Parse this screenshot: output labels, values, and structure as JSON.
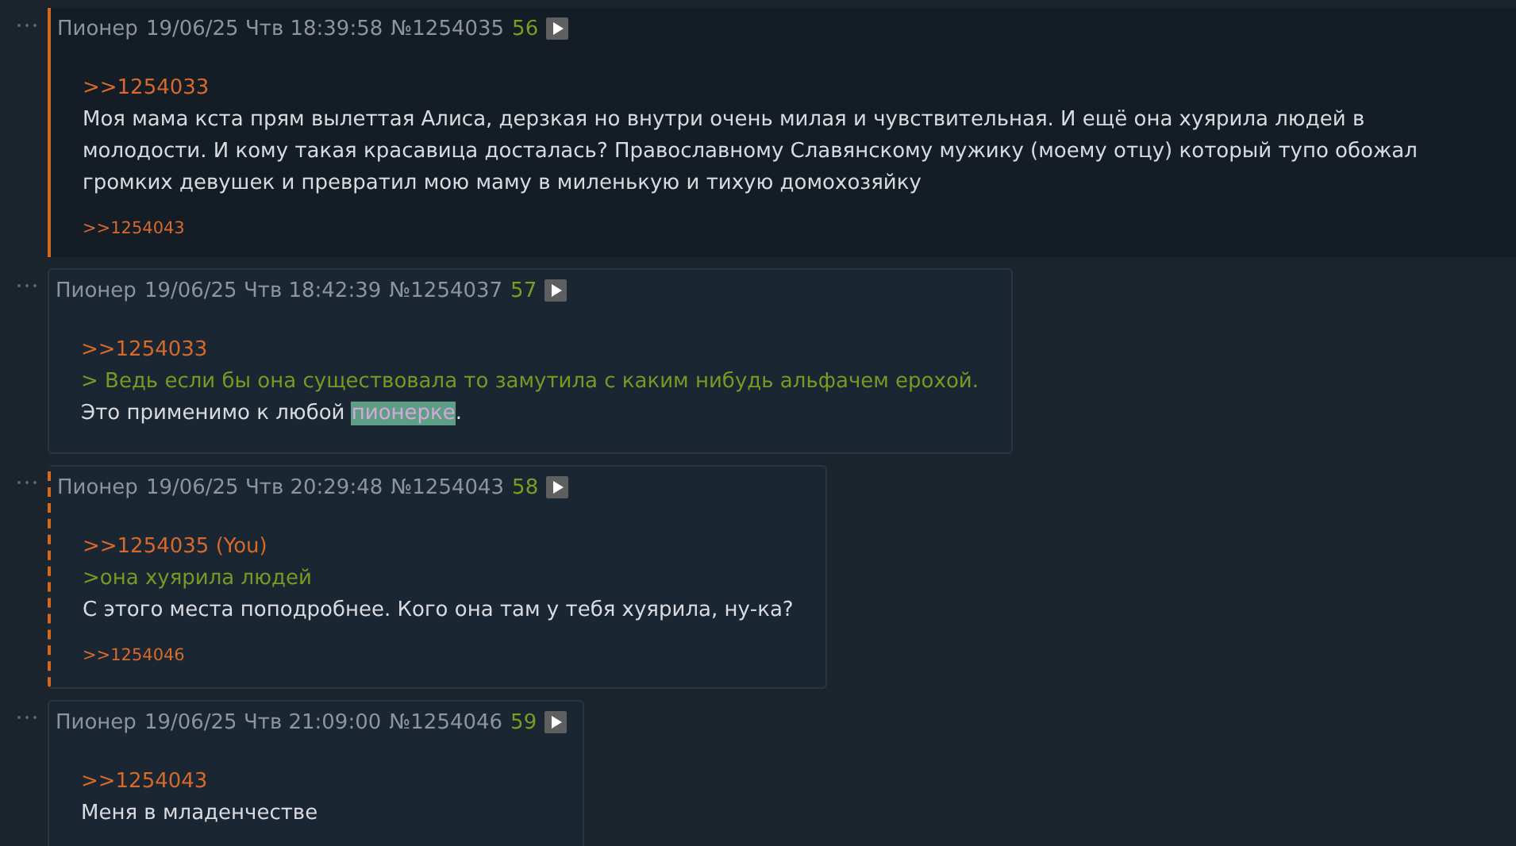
{
  "posts": [
    {
      "kind": "highlighted",
      "name": "Пионер",
      "date": "19/06/25 Чтв 18:39:58",
      "number": "№1254035",
      "counter": "56",
      "lines": [
        {
          "kind": "link",
          "parts": [
            {
              "text": ">>1254033"
            }
          ]
        },
        {
          "kind": "text",
          "parts": [
            {
              "text": "Моя мама кста прям вылеттая Алиса, дерзкая но внутри очень милая и чувствительная. И ещё она хуярила людей в молодости. И кому такая красавица досталась? Православному Славянскому мужику (моему отцу) который тупо обожал громких девушек и превратил мою маму в миленькую и тихую домохозяйку"
            }
          ]
        }
      ],
      "replies": [
        ">>1254043"
      ]
    },
    {
      "kind": "normal",
      "name": "Пионер",
      "date": "19/06/25 Чтв 18:42:39",
      "number": "№1254037",
      "counter": "57",
      "lines": [
        {
          "kind": "link",
          "parts": [
            {
              "text": ">>1254033"
            }
          ]
        },
        {
          "kind": "quote",
          "parts": [
            {
              "text": "> Ведь если бы она существовала то замутила с каким нибудь альфачем ерохой."
            }
          ]
        },
        {
          "kind": "text",
          "parts": [
            {
              "text": "Это применимо к любой "
            },
            {
              "text": "пионерке",
              "kind": "spoiler"
            },
            {
              "text": "."
            }
          ]
        }
      ]
    },
    {
      "kind": "reply-target",
      "name": "Пионер",
      "date": "19/06/25 Чтв 20:29:48",
      "number": "№1254043",
      "counter": "58",
      "lines": [
        {
          "kind": "link",
          "parts": [
            {
              "text": ">>1254035 (You)"
            }
          ]
        },
        {
          "kind": "quote",
          "parts": [
            {
              "text": ">она хуярила людей"
            }
          ]
        },
        {
          "kind": "text",
          "parts": [
            {
              "text": "С этого места поподробнее. Кого она там у тебя хуярила, ну-ка?"
            }
          ]
        }
      ],
      "replies": [
        ">>1254046"
      ]
    },
    {
      "kind": "normal",
      "name": "Пионер",
      "date": "19/06/25 Чтв 21:09:00",
      "number": "№1254046",
      "counter": "59",
      "lines": [
        {
          "kind": "link",
          "parts": [
            {
              "text": ">>1254043"
            }
          ]
        },
        {
          "kind": "text",
          "parts": [
            {
              "text": "Меня в младенчестве"
            }
          ]
        }
      ]
    }
  ]
}
